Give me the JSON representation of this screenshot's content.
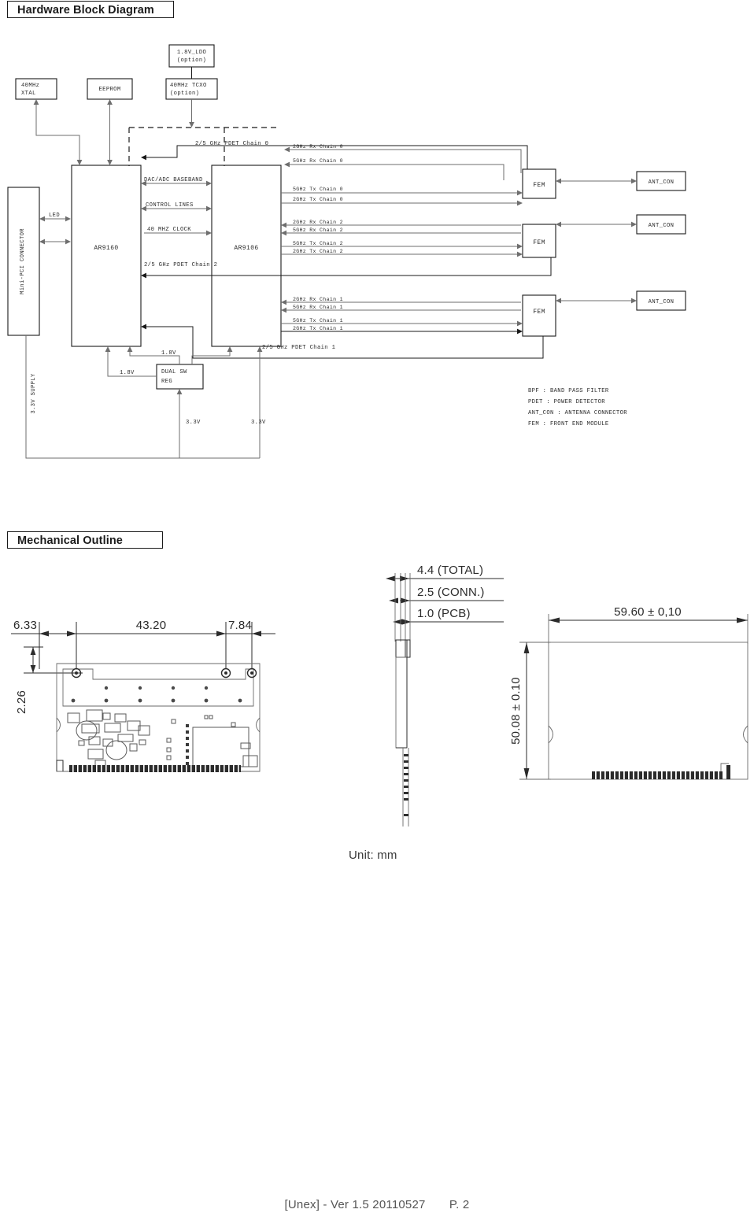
{
  "document": {
    "footer_text": "[Unex] - Ver 1.5 20110527",
    "page_label": "P. 2"
  },
  "sections": {
    "hardware": {
      "title": "Hardware Block Diagram"
    },
    "mechanical": {
      "title": "Mechanical Outline",
      "unit_note": "Unit: mm"
    }
  },
  "block_diagram": {
    "blocks": {
      "ldo": "1.8V_LDO",
      "ldo_sub": "(option)",
      "xtal_l1": "40MHz",
      "xtal_l2": "XTAL",
      "eeprom": "EEPROM",
      "tcxo": "40MHz  TCXO",
      "tcxo_sub": "(option)",
      "mini_pci": "Mini-PCI CONNECTOR",
      "ar9160": "AR9160",
      "ar9106": "AR9106",
      "dualsw_l1": "DUAL SW",
      "dualsw_l2": "REG",
      "fem0": "FEM",
      "fem2": "FEM",
      "fem1": "FEM",
      "ant0": "ANT_CON",
      "ant2": "ANT_CON",
      "ant1": "ANT_CON"
    },
    "bus_labels": {
      "pdet0": "2/5 GHz PDET Chain 0",
      "pdet2": "2/5 GHz PDET Chain 2",
      "pdet1": "2/5 GHz PDET Chain 1",
      "baseband": "DAC/ADC BASEBAND",
      "control": "CONTROL LINES",
      "clock": "40 MHZ CLOCK",
      "led": "LED"
    },
    "power_labels": {
      "supply": "3.3V SUPPLY",
      "v18_a": "1.8V",
      "v18_b": "1.8V",
      "v33_a": "3.3V",
      "v33_b": "3.3V"
    },
    "chains": [
      {
        "label": "2GHz Rx Chain 0"
      },
      {
        "label": "5GHz Rx Chain 0"
      },
      {
        "label": "5GHz Tx Chain 0"
      },
      {
        "label": "2GHz Tx Chain 0"
      },
      {
        "label": "2GHz Rx Chain 2"
      },
      {
        "label": "5GHz Rx Chain 2"
      },
      {
        "label": "5GHz Tx Chain 2"
      },
      {
        "label": "2GHz Tx Chain 2"
      },
      {
        "label": "2GHz Rx Chain 1"
      },
      {
        "label": "5GHz Rx Chain 1"
      },
      {
        "label": "5GHz Tx Chain 1"
      },
      {
        "label": "2GHz Tx Chain 1"
      }
    ],
    "legend": [
      "BPF  : BAND PASS FILTER",
      "PDET : POWER DETECTOR",
      "ANT_CON  : ANTENNA CONNECTOR",
      "FEM : FRONT END MODULE"
    ]
  },
  "mechanical_outline": {
    "top_view_dims": {
      "d_left": "6.33",
      "d_span": "43.20",
      "d_right": "7.84",
      "d_vert": "2.26"
    },
    "side_view_dims": {
      "total": "4.4 (TOTAL)",
      "conn": "2.5 (CONN.)",
      "pcb": "1.0 (PCB)"
    },
    "bottom_view_dims": {
      "width": "59.60 ± 0,10",
      "height": "50.08 ± 0.10"
    }
  }
}
